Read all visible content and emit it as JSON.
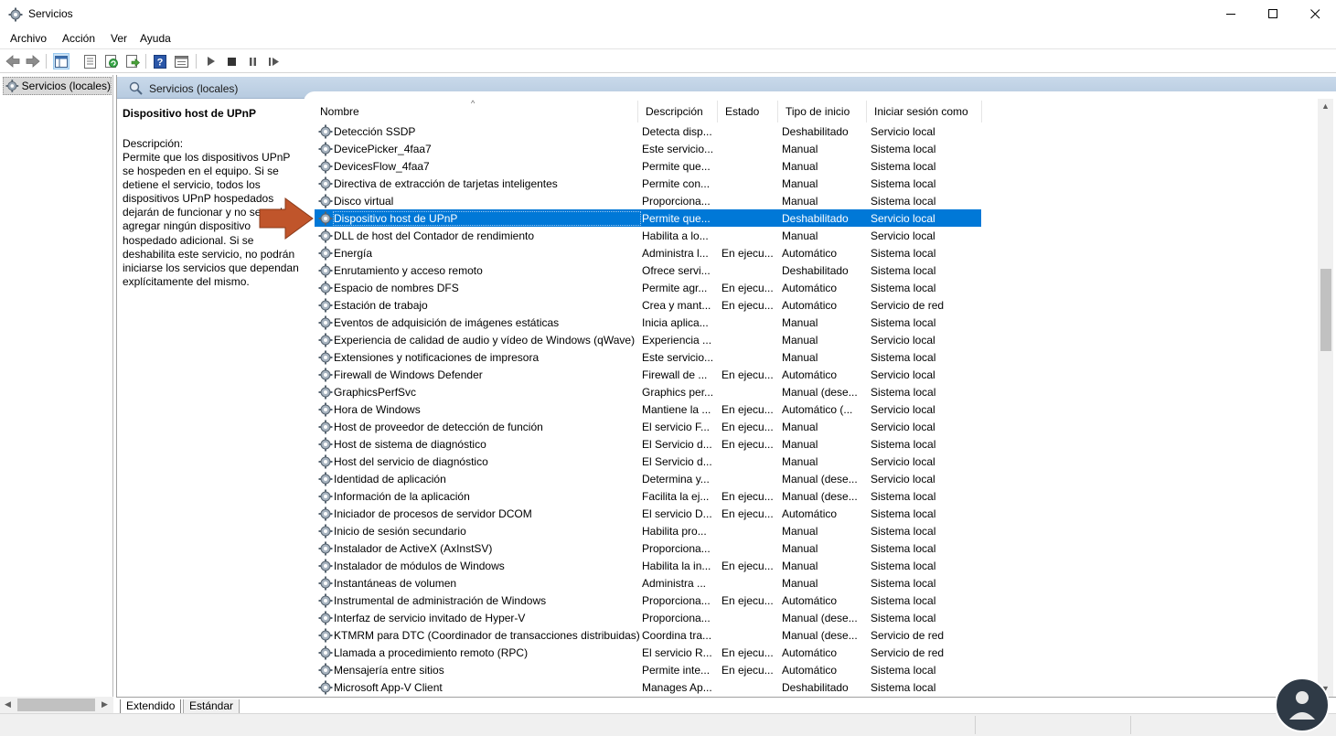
{
  "window": {
    "title": "Servicios"
  },
  "menu": {
    "items": [
      "Archivo",
      "Acción",
      "Ver",
      "Ayuda"
    ]
  },
  "tree": {
    "root_label": "Servicios (locales)"
  },
  "panel": {
    "header_title": "Servicios (locales)"
  },
  "description": {
    "service_title": "Dispositivo host de UPnP",
    "label": "Descripción:",
    "text": "Permite que los dispositivos UPnP se hospeden en el equipo. Si se detiene el servicio, todos los dispositivos UPnP hospedados dejarán de funcionar y no se podrá agregar ningún dispositivo hospedado adicional. Si se deshabilita este servicio, no podrán iniciarse los servicios que dependan explícitamente del mismo."
  },
  "columns": [
    "Nombre",
    "Descripción",
    "Estado",
    "Tipo de inicio",
    "Iniciar sesión como"
  ],
  "rows": [
    [
      "Detección SSDP",
      "Detecta disp...",
      "",
      "Deshabilitado",
      "Servicio local"
    ],
    [
      "DevicePicker_4faa7",
      "Este servicio...",
      "",
      "Manual",
      "Sistema local"
    ],
    [
      "DevicesFlow_4faa7",
      "Permite que...",
      "",
      "Manual",
      "Sistema local"
    ],
    [
      "Directiva de extracción de tarjetas inteligentes",
      "Permite con...",
      "",
      "Manual",
      "Sistema local"
    ],
    [
      "Disco virtual",
      "Proporciona...",
      "",
      "Manual",
      "Sistema local"
    ],
    [
      "Dispositivo host de UPnP",
      "Permite que...",
      "",
      "Deshabilitado",
      "Servicio local"
    ],
    [
      "DLL de host del Contador de rendimiento",
      "Habilita a lo...",
      "",
      "Manual",
      "Servicio local"
    ],
    [
      "Energía",
      "Administra l...",
      "En ejecu...",
      "Automático",
      "Sistema local"
    ],
    [
      "Enrutamiento y acceso remoto",
      "Ofrece servi...",
      "",
      "Deshabilitado",
      "Sistema local"
    ],
    [
      "Espacio de nombres DFS",
      "Permite agr...",
      "En ejecu...",
      "Automático",
      "Sistema local"
    ],
    [
      "Estación de trabajo",
      "Crea y mant...",
      "En ejecu...",
      "Automático",
      "Servicio de red"
    ],
    [
      "Eventos de adquisición de imágenes estáticas",
      "Inicia aplica...",
      "",
      "Manual",
      "Sistema local"
    ],
    [
      "Experiencia de calidad de audio y vídeo de Windows (qWave)",
      "Experiencia ...",
      "",
      "Manual",
      "Servicio local"
    ],
    [
      "Extensiones y notificaciones de impresora",
      "Este servicio...",
      "",
      "Manual",
      "Sistema local"
    ],
    [
      "Firewall de Windows Defender",
      "Firewall de ...",
      "En ejecu...",
      "Automático",
      "Servicio local"
    ],
    [
      "GraphicsPerfSvc",
      "Graphics per...",
      "",
      "Manual (dese...",
      "Sistema local"
    ],
    [
      "Hora de Windows",
      "Mantiene la ...",
      "En ejecu...",
      "Automático (...",
      "Servicio local"
    ],
    [
      "Host de proveedor de detección de función",
      "El servicio F...",
      "En ejecu...",
      "Manual",
      "Servicio local"
    ],
    [
      "Host de sistema de diagnóstico",
      "El Servicio d...",
      "En ejecu...",
      "Manual",
      "Sistema local"
    ],
    [
      "Host del servicio de diagnóstico",
      "El Servicio d...",
      "",
      "Manual",
      "Servicio local"
    ],
    [
      "Identidad de aplicación",
      "Determina y...",
      "",
      "Manual (dese...",
      "Servicio local"
    ],
    [
      "Información de la aplicación",
      "Facilita la ej...",
      "En ejecu...",
      "Manual (dese...",
      "Sistema local"
    ],
    [
      "Iniciador de procesos de servidor DCOM",
      "El servicio D...",
      "En ejecu...",
      "Automático",
      "Sistema local"
    ],
    [
      "Inicio de sesión secundario",
      "Habilita pro...",
      "",
      "Manual",
      "Sistema local"
    ],
    [
      "Instalador de ActiveX (AxInstSV)",
      "Proporciona...",
      "",
      "Manual",
      "Sistema local"
    ],
    [
      "Instalador de módulos de Windows",
      "Habilita la in...",
      "En ejecu...",
      "Manual",
      "Sistema local"
    ],
    [
      "Instantáneas de volumen",
      "Administra ...",
      "",
      "Manual",
      "Sistema local"
    ],
    [
      "Instrumental de administración de Windows",
      "Proporciona...",
      "En ejecu...",
      "Automático",
      "Sistema local"
    ],
    [
      "Interfaz de servicio invitado de Hyper-V",
      "Proporciona...",
      "",
      "Manual (dese...",
      "Sistema local"
    ],
    [
      "KTMRM para DTC (Coordinador de transacciones distribuidas)",
      "Coordina tra...",
      "",
      "Manual (dese...",
      "Servicio de red"
    ],
    [
      "Llamada a procedimiento remoto (RPC)",
      "El servicio R...",
      "En ejecu...",
      "Automático",
      "Servicio de red"
    ],
    [
      "Mensajería entre sitios",
      "Permite inte...",
      "En ejecu...",
      "Automático",
      "Sistema local"
    ],
    [
      "Microsoft App-V Client",
      "Manages Ap...",
      "",
      "Deshabilitado",
      "Sistema local"
    ]
  ],
  "selected_row_index": 5,
  "tabs": [
    "Extendido",
    "Estándar"
  ],
  "colors": {
    "selection": "#0078d7",
    "header_gradient": "#c9d9ea",
    "arrow": "#c0552b"
  }
}
